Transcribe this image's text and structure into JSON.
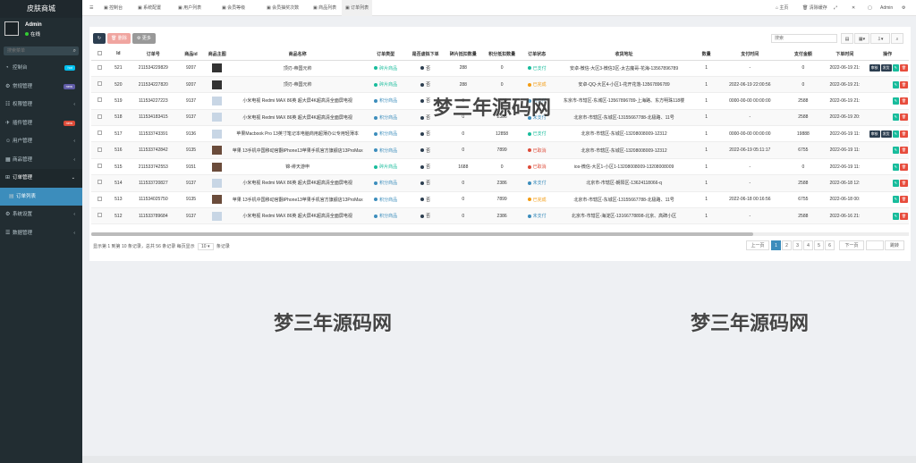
{
  "app": {
    "title": "皮肤商城",
    "user": "Admin",
    "status": "在线",
    "search_placeholder": "搜索菜单"
  },
  "sidebar": {
    "items": [
      {
        "label": "控制台",
        "icon": "dashboard-icon",
        "badge": "hot",
        "badge_color": "#00c0ef"
      },
      {
        "label": "常规管理",
        "icon": "cog-icon",
        "badge": "new",
        "badge_color": "#605ca8"
      },
      {
        "label": "权限管理",
        "icon": "users-icon",
        "badge": "",
        "badge_color": ""
      },
      {
        "label": "插件管理",
        "icon": "rocket-icon",
        "badge": "new",
        "badge_color": "#dd4b39"
      },
      {
        "label": "用户管理",
        "icon": "user-icon",
        "badge": "",
        "badge_color": ""
      },
      {
        "label": "商品管理",
        "icon": "grid-icon",
        "badge": "",
        "badge_color": ""
      },
      {
        "label": "订单管理",
        "icon": "cart-icon",
        "badge": "",
        "badge_color": ""
      },
      {
        "label": "订单列表",
        "icon": "list-icon",
        "badge": "",
        "badge_color": ""
      },
      {
        "label": "系统设置",
        "icon": "gear-icon",
        "badge": "",
        "badge_color": ""
      },
      {
        "label": "数据管理",
        "icon": "database-icon",
        "badge": "",
        "badge_color": ""
      }
    ]
  },
  "topbar": {
    "tabs": [
      "控制台",
      "系统配置",
      "用户列表",
      "会员等级",
      "会员抽奖次数",
      "商品列表",
      "订单列表"
    ],
    "right": [
      "主页",
      "清除缓存",
      "Admin"
    ]
  },
  "toolbar": {
    "delete": "删除",
    "more": "更多",
    "search_placeholder": "搜索"
  },
  "table": {
    "headers": [
      "Id",
      "订单号",
      "商品id",
      "商品主图",
      "商品名称",
      "订单类型",
      "是否虚拟下单",
      "碎片抵扣数量",
      "积分抵扣数量",
      "订单状态",
      "收货地址",
      "数量",
      "支付时间",
      "支付金额",
      "下单时间",
      "操作"
    ],
    "rows": [
      {
        "id": "521",
        "order": "211534229829",
        "gid": "9207",
        "name": "顶刃-帝国元帅",
        "type": "碎片商品",
        "type_color": "#18bc9c",
        "virtual": "否",
        "frag": "288",
        "points": "0",
        "status": "已支付",
        "status_color": "#18bc9c",
        "addr": "安卓-微信-大区3-微信3区-太古魔哥-花海-13567896789",
        "qty": "1",
        "paytime": "-",
        "amount": "0",
        "ordertime": "2022-06-19 21:",
        "thumb": "dark",
        "ops": [
          "审核",
          "发货"
        ]
      },
      {
        "id": "520",
        "order": "211534227820",
        "gid": "9207",
        "name": "顶刃-帝国元帅",
        "type": "碎片商品",
        "type_color": "#18bc9c",
        "virtual": "否",
        "frag": "288",
        "points": "0",
        "status": "已完成",
        "status_color": "#f39c12",
        "addr": "安卓-QQ-大区4-小区1-花开花落-13567896789",
        "qty": "1",
        "paytime": "2022-06-19 22:00:56",
        "amount": "0",
        "ordertime": "2022-06-19 21:",
        "thumb": "dark",
        "ops": []
      },
      {
        "id": "519",
        "order": "111534227223",
        "gid": "9137",
        "name": "小米电视 Redmi MAX 86英 超大屏4K超高清全面屏电视",
        "type": "积分商品",
        "type_color": "#3c8dbc",
        "virtual": "否",
        "frag": "0",
        "points": "2386",
        "status": "未支付",
        "status_color": "#3c8dbc",
        "addr": "东京市-市辖区-东城区-13567896789-上海路、东方明珠118楼",
        "qty": "1",
        "paytime": "0000-00-00 00:00:00",
        "amount": "2588",
        "ordertime": "2022-06-19 21:",
        "thumb": "light",
        "ops": []
      },
      {
        "id": "518",
        "order": "111534183415",
        "gid": "9137",
        "name": "小米电视 Redmi MAX 86英 超大屏4K超高清全面屏电视",
        "type": "积分商品",
        "type_color": "#3c8dbc",
        "virtual": "否",
        "frag": "0",
        "points": "2386",
        "status": "未支付",
        "status_color": "#3c8dbc",
        "addr": "北京市-市辖区-东城区-13155667788-北极路、11号",
        "qty": "1",
        "paytime": "-",
        "amount": "2588",
        "ordertime": "2022-06-19 20:",
        "thumb": "light",
        "ops": []
      },
      {
        "id": "517",
        "order": "111533743391",
        "gid": "9136",
        "name": "苹果Macbook Pro 13英寸笔记本电脑商用超薄办公专用轻薄本",
        "type": "积分商品",
        "type_color": "#3c8dbc",
        "virtual": "否",
        "frag": "0",
        "points": "12858",
        "status": "已支付",
        "status_color": "#18bc9c",
        "addr": "北京市-市辖区-东城区-13208008009-12312",
        "qty": "1",
        "paytime": "0000-00-00 00:00:00",
        "amount": "19888",
        "ordertime": "2022-06-19 11:",
        "thumb": "light",
        "ops": [
          "审核",
          "发货"
        ]
      },
      {
        "id": "516",
        "order": "111533742842",
        "gid": "9135",
        "name": "苹果 13手机中国移动官翻iPhone13苹果手机官方旗舰店13ProMax",
        "type": "积分商品",
        "type_color": "#3c8dbc",
        "virtual": "否",
        "frag": "0",
        "points": "7899",
        "status": "已取消",
        "status_color": "#dd4b39",
        "addr": "北京市-市辖区-东城区-13208008009-12312",
        "qty": "1",
        "paytime": "2022-06-19 05:11:17",
        "amount": "6755",
        "ordertime": "2022-06-19 11:",
        "thumb": "mixed",
        "ops": []
      },
      {
        "id": "515",
        "order": "211533742553",
        "gid": "9151",
        "name": "锦-绯天游申",
        "type": "碎片商品",
        "type_color": "#18bc9c",
        "virtual": "否",
        "frag": "1688",
        "points": "0",
        "status": "已取消",
        "status_color": "#dd4b39",
        "addr": "ios-微信-大区1-小区1-13208008009-13208008009",
        "qty": "1",
        "paytime": "-",
        "amount": "0",
        "ordertime": "2022-06-19 11:",
        "thumb": "mixed",
        "ops": []
      },
      {
        "id": "514",
        "order": "111533720827",
        "gid": "9137",
        "name": "小米电视 Redmi MAX 86英 超大屏4K超高清全面屏电视",
        "type": "积分商品",
        "type_color": "#3c8dbc",
        "virtual": "否",
        "frag": "0",
        "points": "2386",
        "status": "未支付",
        "status_color": "#3c8dbc",
        "addr": "北京市-市辖区-朝阳区-13624118066-q",
        "qty": "1",
        "paytime": "-",
        "amount": "2588",
        "ordertime": "2022-06-18 12:",
        "thumb": "light",
        "ops": []
      },
      {
        "id": "513",
        "order": "111534025750",
        "gid": "9135",
        "name": "苹果 13手机中国移动官翻iPhone13苹果手机官方旗舰店13ProMax",
        "type": "积分商品",
        "type_color": "#3c8dbc",
        "virtual": "否",
        "frag": "0",
        "points": "7899",
        "status": "已完成",
        "status_color": "#f39c12",
        "addr": "北京市-市辖区-东城区-13155667788-北极路、11号",
        "qty": "1",
        "paytime": "2022-06-18 00:16:56",
        "amount": "6755",
        "ordertime": "2022-06-18 00:",
        "thumb": "mixed",
        "ops": []
      },
      {
        "id": "512",
        "order": "111533789684",
        "gid": "9137",
        "name": "小米电视 Redmi MAX 86英 超大屏4K超高清全面屏电视",
        "type": "积分商品",
        "type_color": "#3c8dbc",
        "virtual": "否",
        "frag": "0",
        "points": "2386",
        "status": "未支付",
        "status_color": "#3c8dbc",
        "addr": "北京市-市辖区-海淀区-13166778898-北京、高碑小区",
        "qty": "1",
        "paytime": "-",
        "amount": "2588",
        "ordertime": "2022-06-16 21:",
        "thumb": "light",
        "ops": []
      }
    ]
  },
  "pagination": {
    "info": "显示第 1 到第 10 条记录，总共 56 条记录 每页显示",
    "page_size": "10",
    "after": "条记录",
    "prev": "上一页",
    "pages": [
      "1",
      "2",
      "3",
      "4",
      "5",
      "6"
    ],
    "next": "下一页",
    "jump": "跳转"
  },
  "watermarks": [
    "梦三年源码网",
    "梦三年源码网",
    "梦三年源码网"
  ]
}
